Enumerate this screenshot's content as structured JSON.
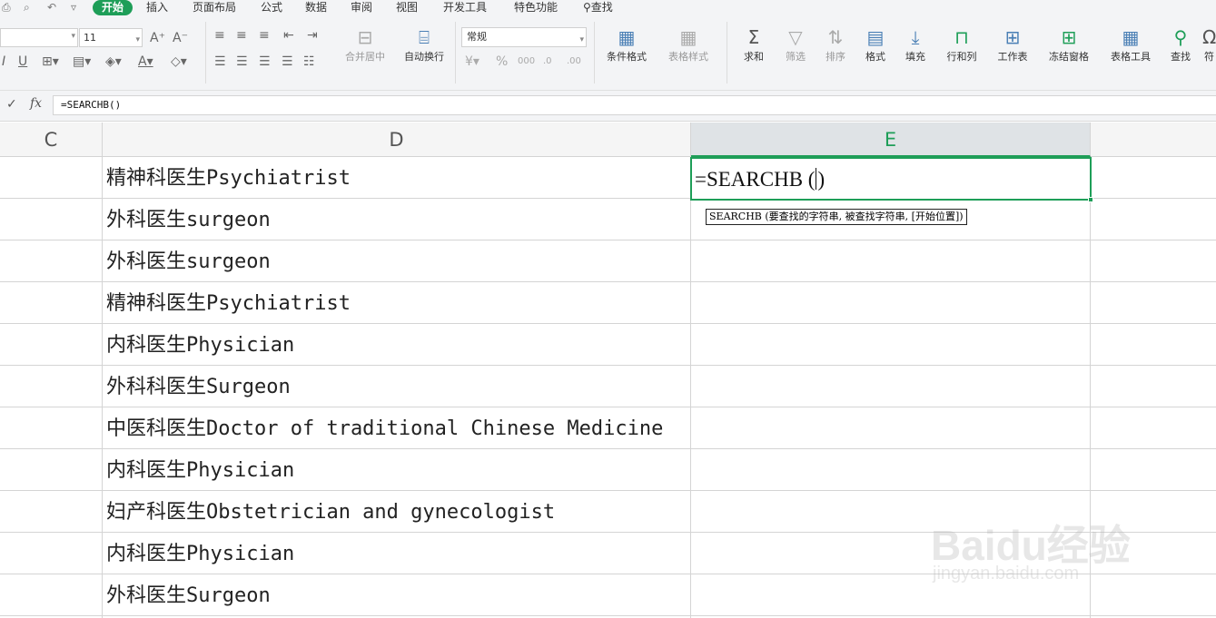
{
  "menu": {
    "tabs": [
      "开始",
      "插入",
      "页面布局",
      "公式",
      "数据",
      "审阅",
      "视图",
      "开发工具",
      "特色功能"
    ],
    "active_tab": "开始",
    "search_label": "查找"
  },
  "ribbon": {
    "font_size": "11",
    "number_format": "常规",
    "buttons": {
      "merge_center": "合并居中",
      "wrap_text": "自动换行",
      "conditional_format": "条件格式",
      "table_style": "表格样式",
      "sum": "求和",
      "filter": "筛选",
      "sort": "排序",
      "format": "格式",
      "fill": "填充",
      "row_col": "行和列",
      "worksheet": "工作表",
      "freeze": "冻结窗格",
      "table_tools": "表格工具",
      "find": "查找",
      "symbol": "符"
    }
  },
  "formula_bar": {
    "fx": "fx",
    "value": "=SEARCHB()"
  },
  "columns": {
    "c": "C",
    "d": "D",
    "e": "E"
  },
  "rows": [
    "精神科医生Psychiatrist",
    "外科医生surgeon",
    "外科医生surgeon",
    "精神科医生Psychiatrist",
    "内科医生Physician",
    "外科科医生Surgeon",
    "中医科医生Doctor of traditional Chinese Medicine",
    "内科医生Physician",
    "妇产科医生Obstetrician and gynecologist",
    "内科医生Physician",
    "外科医生Surgeon"
  ],
  "active_cell": {
    "formula_left": "=SEARCHB (",
    "formula_right": ")"
  },
  "tooltip": "SEARCHB (要查找的字符串, 被查找字符串, [开始位置])",
  "watermark": {
    "brand": "Baidu经验",
    "url": "jingyan.baidu.com"
  },
  "colors": {
    "accent": "#1e9e58",
    "grid": "#d4d4d4"
  }
}
